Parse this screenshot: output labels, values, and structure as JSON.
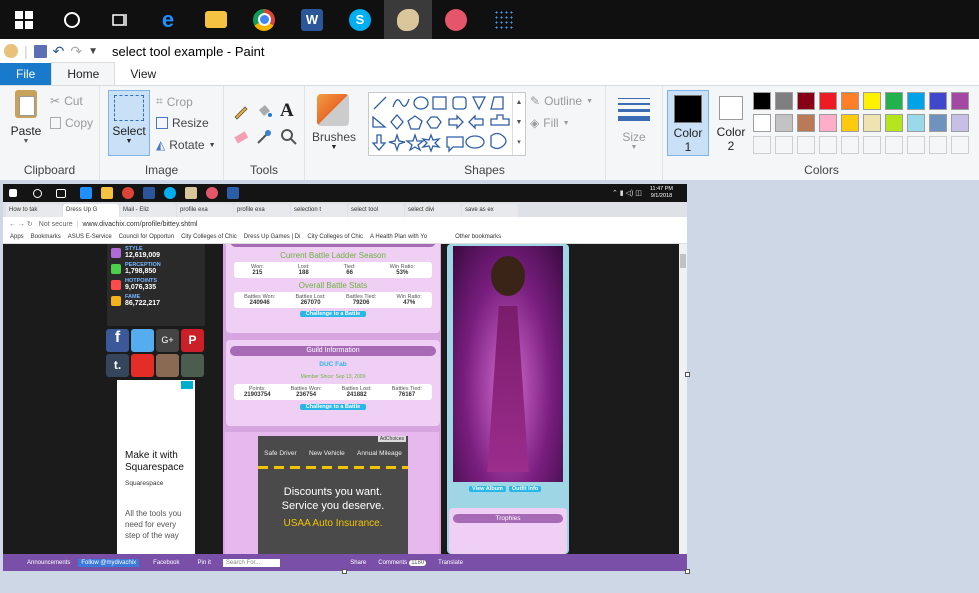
{
  "window": {
    "title": "select tool example - Paint"
  },
  "tabs": {
    "file": "File",
    "home": "Home",
    "view": "View"
  },
  "ribbon": {
    "clipboard": {
      "label": "Clipboard",
      "paste": "Paste",
      "cut": "Cut",
      "copy": "Copy"
    },
    "image": {
      "label": "Image",
      "select": "Select",
      "crop": "Crop",
      "resize": "Resize",
      "rotate": "Rotate"
    },
    "tools": {
      "label": "Tools"
    },
    "brushes": {
      "label": "Brushes"
    },
    "shapes": {
      "label": "Shapes",
      "outline": "Outline",
      "fill": "Fill"
    },
    "size": {
      "label": "Size"
    },
    "color1": {
      "label": "Color\n1",
      "line1": "Color",
      "line2": "1",
      "value": "#000000"
    },
    "color2": {
      "label": "Color 2",
      "line1": "Color",
      "line2": "2",
      "value": "#ffffff"
    },
    "colors": {
      "label": "Colors",
      "row1": [
        "#000000",
        "#7f7f7f",
        "#880015",
        "#ed1c24",
        "#ff7f27",
        "#fff200",
        "#22b14c",
        "#00a2e8",
        "#3f48cc",
        "#a349a4"
      ],
      "row2": [
        "#ffffff",
        "#c3c3c3",
        "#b97a57",
        "#ffaec9",
        "#ffc90e",
        "#efe4b0",
        "#b5e61d",
        "#99d9ea",
        "#7092be",
        "#c8bfe7"
      ],
      "row3": [
        "#f5f6f7",
        "#f5f6f7",
        "#f5f6f7",
        "#f5f6f7",
        "#f5f6f7",
        "#f5f6f7",
        "#f5f6f7",
        "#f5f6f7",
        "#f5f6f7",
        "#f5f6f7"
      ]
    }
  },
  "inner": {
    "clock": {
      "time": "11:47 PM",
      "date": "9/1/2018"
    },
    "tabs": [
      "How to tak",
      "Dress Up G",
      "Mail - Eliz",
      "profile exa",
      "profile exa",
      "selection t",
      "select tool",
      "select divi",
      "save as ex"
    ],
    "address": {
      "secure": "Not secure",
      "url": "www.divachix.com/profile/bittey.shtml"
    },
    "bookmarks": [
      "Apps",
      "Bookmarks",
      "ASUS E-Service",
      "Council for Opportun",
      "City Colleges of Chic",
      "Dress Up Games | Di",
      "City Colleges of Chic",
      "A Health Plan with Yo",
      "Other bookmarks"
    ],
    "stats": [
      {
        "label": "STYLE",
        "value": "12,619,009"
      },
      {
        "label": "PERCEPTION",
        "value": "1,798,850"
      },
      {
        "label": "HOTPOINTS",
        "value": "9,076,335"
      },
      {
        "label": "FAME",
        "value": "86,722,217"
      }
    ],
    "ladder": {
      "title": "Current Battle Ladder Season",
      "headers": [
        "Won:",
        "Lost:",
        "Tied:",
        "Win Ratio:"
      ],
      "values": [
        "215",
        "188",
        "66",
        "53%"
      ]
    },
    "overall": {
      "title": "Overall Battle Stats",
      "headers": [
        "Battles Won:",
        "Battles Lost:",
        "Battles Tied:",
        "Win Ratio:"
      ],
      "values": [
        "240946",
        "267070",
        "79206",
        "47%"
      ],
      "button": "Challenge to a Battle"
    },
    "guild": {
      "title": "Guild Information",
      "name": "DUC Fab",
      "since": "Member Since: Sep 13, 2009",
      "headers": [
        "Points:",
        "Battles Won:",
        "Battles Lost:",
        "Battles Tied:"
      ],
      "values": [
        "21903754",
        "236754",
        "241882",
        "76167"
      ],
      "button": "Challenge to a Battle"
    },
    "ad_left": {
      "title": "Make it with Squarespace",
      "brand": "Squarespace",
      "body": "All the tools you need for every step of the way"
    },
    "ad_center": {
      "choices": "AdChoices",
      "tabs": [
        "Safe Driver",
        "New Vehicle",
        "Annual Mileage"
      ],
      "line1": "Discounts you want.",
      "line2": "Service you deserve.",
      "brand": "USAA Auto Insurance."
    },
    "avatar": {
      "view_album": "View Album",
      "outfit_info": "Outfit Info",
      "trophies": "Trophies"
    },
    "bottom": [
      "Announcements",
      "Follow @mydivachix",
      "Facebook",
      "Pin it",
      "Search For...",
      "Share",
      "Comments",
      "1180",
      "Translate"
    ]
  }
}
